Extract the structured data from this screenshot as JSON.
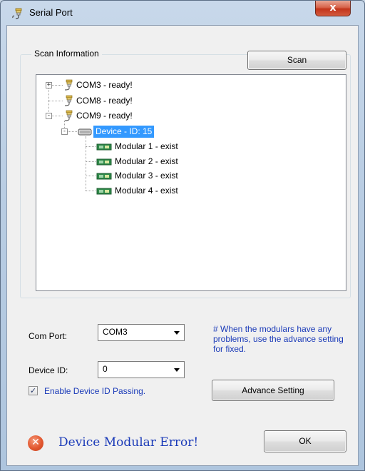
{
  "window": {
    "title": "Serial Port",
    "close_glyph": "x"
  },
  "group": {
    "label": "Scan Information"
  },
  "buttons": {
    "scan": "Scan",
    "advance": "Advance Setting",
    "ok": "OK"
  },
  "tree": {
    "ports": [
      {
        "label": "COM3 - ready!",
        "expander": "+"
      },
      {
        "label": "COM8 - ready!",
        "expander": ""
      },
      {
        "label": "COM9 - ready!",
        "expander": "-"
      }
    ],
    "device": {
      "label": "Device - ID: 15",
      "expander": "-"
    },
    "modulars": [
      {
        "label": "Modular 1 - exist"
      },
      {
        "label": "Modular 2 - exist"
      },
      {
        "label": "Modular 3 - exist"
      },
      {
        "label": "Modular 4 - exist"
      }
    ]
  },
  "form": {
    "com_port_label": "Com Port:",
    "com_port_value": "COM3",
    "device_id_label": "Device ID:",
    "device_id_value": "0",
    "hint": "# When the modulars have any problems, use the advance setting for fixed.",
    "enable_passing_label": "Enable Device ID Passing.",
    "enable_passing_checked": true
  },
  "status": {
    "icon_glyph": "✕",
    "message": "Device Modular Error!"
  },
  "colors": {
    "accent": "#1a3ab8",
    "selection": "#3399ff",
    "error": "#e2572f"
  }
}
